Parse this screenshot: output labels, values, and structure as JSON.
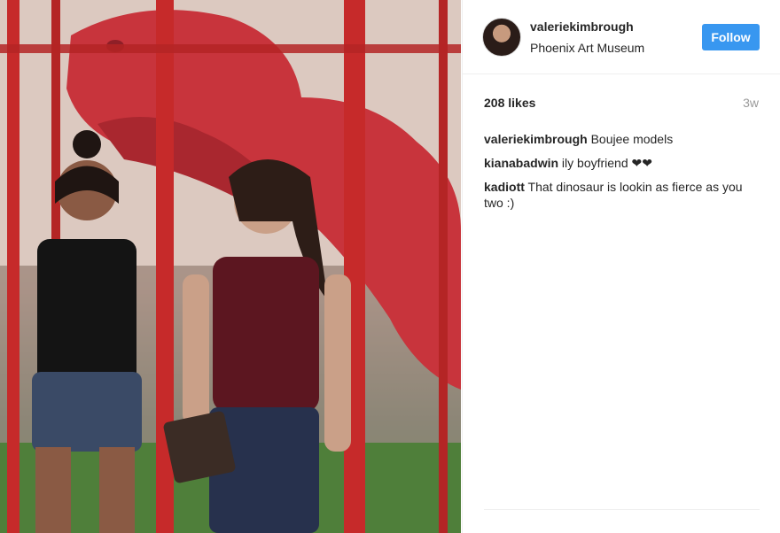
{
  "post": {
    "username": "valeriekimbrough",
    "location": "Phoenix Art Museum",
    "follow_label": "Follow",
    "likes": "208 likes",
    "time": "3w"
  },
  "comments": [
    {
      "author": "valeriekimbrough",
      "text": "Boujee models"
    },
    {
      "author": "kianabadwin",
      "text": "ily boyfriend ❤❤"
    },
    {
      "author": "kadiott",
      "text": "That dinosaur is lookin as fierce as you two :)"
    }
  ],
  "colors": {
    "follow_button": "#3897f0",
    "dinosaur": "#c8343c",
    "scaffold": "#c62a2a"
  }
}
